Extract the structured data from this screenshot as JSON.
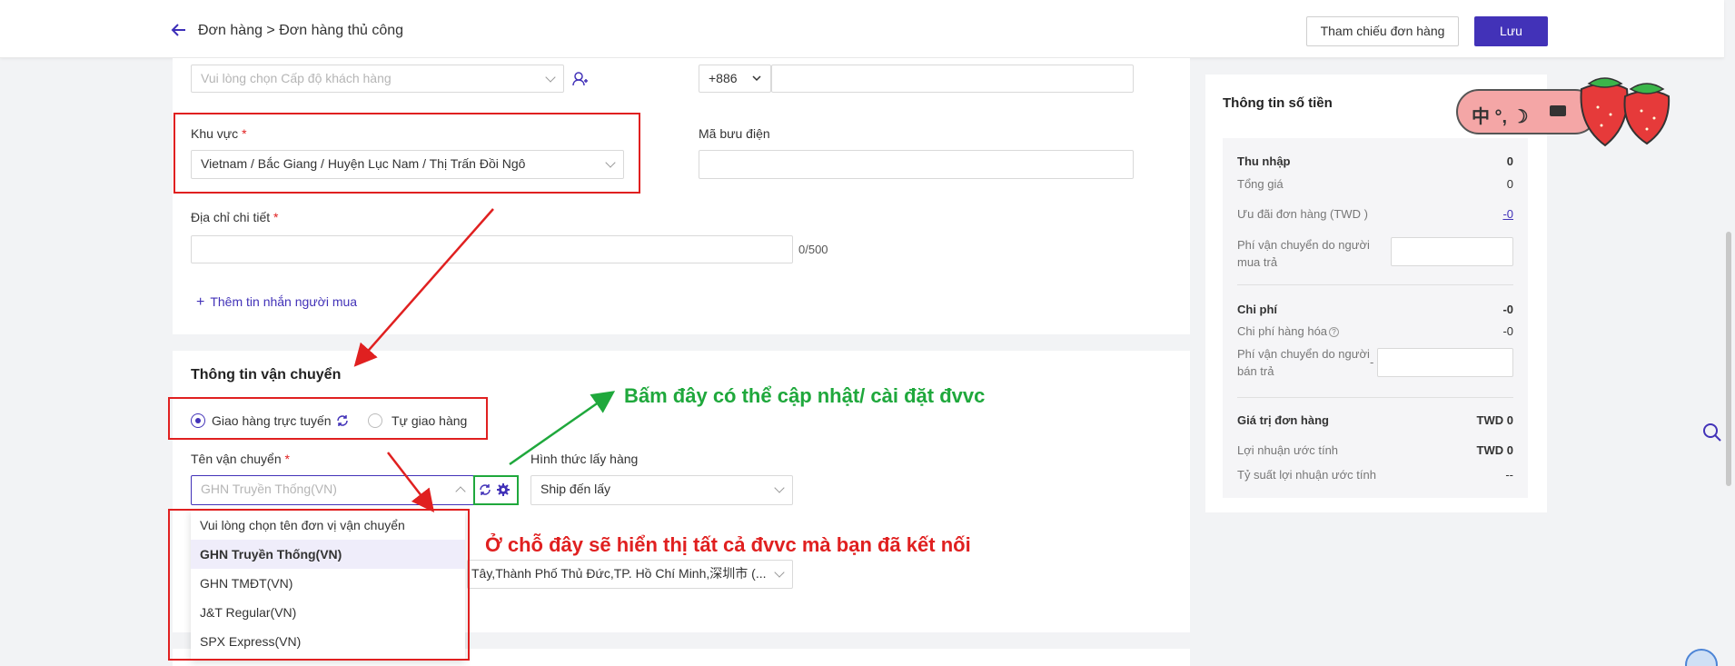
{
  "header": {
    "breadcrumb": "Đơn hàng > Đơn hàng thủ công",
    "reference_button": "Tham chiếu đơn hàng",
    "save_button": "Lưu"
  },
  "customer": {
    "level_placeholder": "Vui lòng chọn Cấp độ khách hàng",
    "phone_code": "+886",
    "phone_value": ""
  },
  "address": {
    "region_label": "Khu vực",
    "region_value": "Vietnam / Bắc Giang / Huyện Lục Nam / Thị Trấn Đồi Ngô",
    "postal_label": "Mã bưu điện",
    "postal_value": "",
    "detail_label": "Địa chỉ chi tiết",
    "detail_value": "",
    "detail_counter": "0/500",
    "add_message": "Thêm tin nhắn người mua",
    "required_mark": "*"
  },
  "shipping": {
    "section_title": "Thông tin vận chuyển",
    "option_online": "Giao hàng trực tuyến",
    "option_self": "Tự giao hàng",
    "carrier_label": "Tên vận chuyển",
    "carrier_value": "GHN Truyền Thống(VN)",
    "pickup_label": "Hình thức lấy hàng",
    "pickup_value": "Ship đến lấy",
    "address_value": "Tây,Thành Phố Thủ Đức,TP. Hồ Chí Minh,深圳市 (...",
    "dropdown": [
      "Vui lòng chọn tên đơn vị vận chuyển",
      "GHN Truyền Thống(VN)",
      "GHN TMĐT(VN)",
      "J&T Regular(VN)",
      "SPX Express(VN)"
    ]
  },
  "annotations": {
    "green_note": "Bấm đây có thể cập nhật/ cài đặt đvvc",
    "red_note": "Ở chỗ đây sẽ hiển thị tất cả đvvc mà bạn đã kết nối"
  },
  "summary": {
    "title": "Thông tin số tiền",
    "income_label": "Thu nhập",
    "income_value": "0",
    "total_label": "Tổng giá",
    "total_value": "0",
    "discount_label": "Ưu đãi đơn hàng (TWD )",
    "discount_value": "-0",
    "buyer_ship_label": "Phí vận chuyển do người mua trả",
    "cost_label": "Chi phí",
    "cost_value": "-0",
    "goods_cost_label": "Chi phí hàng hóa",
    "goods_cost_value": "-0",
    "seller_ship_label": "Phí vận chuyển do người bán trả",
    "seller_ship_prefix": "-",
    "order_value_label": "Giá trị đơn hàng",
    "order_value": "TWD 0",
    "profit_label": "Lợi nhuận ước tính",
    "profit_value": "TWD 0",
    "margin_label": "Tỷ suất lợi nhuận ước tính",
    "margin_value": "--"
  },
  "widget": {
    "chars": "中 °, ☽",
    "color_bg": "#f4a6a6"
  }
}
